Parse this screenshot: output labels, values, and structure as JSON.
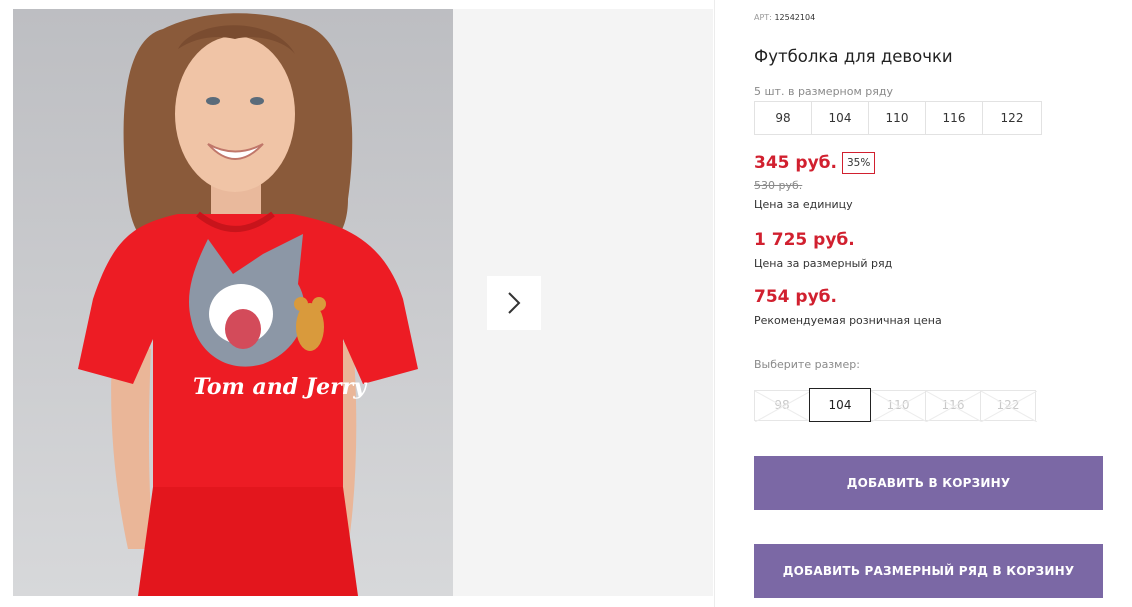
{
  "product": {
    "art_label": "АРТ:",
    "art_number": "12542104",
    "title": "Футболка для девочки",
    "pack_note": "5 шт. в размерном ряду",
    "pack_sizes": [
      "98",
      "104",
      "110",
      "116",
      "122"
    ]
  },
  "prices": {
    "unit_price": "345 руб.",
    "discount_badge": "35%",
    "old_price": "530 руб.",
    "unit_caption": "Цена за единицу",
    "pack_price": "1 725 руб.",
    "pack_caption": "Цена за размерный ряд",
    "retail_price": "754 руб.",
    "retail_caption": "Рекомендуемая розничная цена",
    "accent_color": "#d1202f"
  },
  "size_picker": {
    "label": "Выберите размер:",
    "options": [
      "98",
      "104",
      "110",
      "116",
      "122"
    ],
    "selected": "104"
  },
  "actions": {
    "add_to_cart": "ДОБАВИТЬ В КОРЗИНУ",
    "add_pack_to_cart": "ДОБАВИТЬ РАЗМЕРНЫЙ РЯД В КОРЗИНУ",
    "button_color": "#7b68a5"
  },
  "gallery": {
    "shirt_print_text": "Tom and Jerry",
    "next_icon": "chevron-right-icon"
  }
}
